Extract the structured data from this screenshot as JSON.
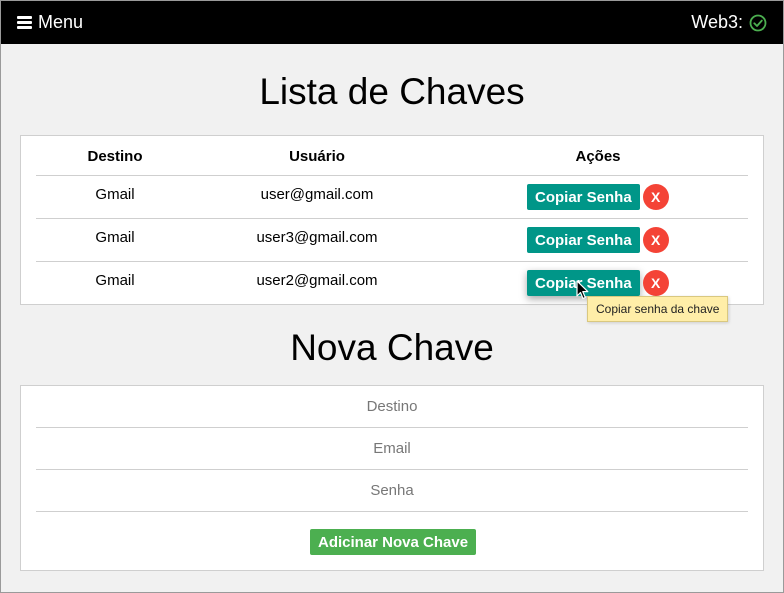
{
  "nav": {
    "menu_label": "Menu",
    "web3_label": "Web3:",
    "web3_status_icon": "check-circle-icon",
    "web3_status_color": "#4caf50"
  },
  "keys_list": {
    "title": "Lista de Chaves",
    "columns": [
      "Destino",
      "Usuário",
      "Ações"
    ],
    "rows": [
      {
        "destino": "Gmail",
        "usuario": "user@gmail.com",
        "copy_label": "Copiar Senha",
        "delete_label": "X"
      },
      {
        "destino": "Gmail",
        "usuario": "user3@gmail.com",
        "copy_label": "Copiar Senha",
        "delete_label": "X"
      },
      {
        "destino": "Gmail",
        "usuario": "user2@gmail.com",
        "copy_label": "Copiar Senha",
        "delete_label": "X"
      }
    ],
    "tooltip": "Copiar senha da chave"
  },
  "new_key": {
    "title": "Nova Chave",
    "destino_placeholder": "Destino",
    "email_placeholder": "Email",
    "senha_placeholder": "Senha",
    "submit_label": "Adicinar Nova Chave"
  },
  "colors": {
    "copy_button": "#009688",
    "delete_button": "#f44336",
    "add_button": "#4caf50",
    "tooltip_bg": "#ffeea8"
  }
}
